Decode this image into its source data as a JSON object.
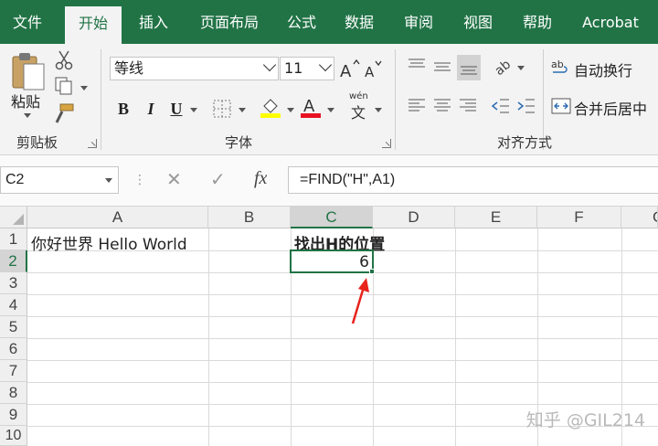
{
  "tabs": [
    "文件",
    "开始",
    "插入",
    "页面布局",
    "公式",
    "数据",
    "审阅",
    "视图",
    "帮助",
    "Acrobat"
  ],
  "active_tab": "开始",
  "ribbon": {
    "clipboard": {
      "paste_label": "粘贴",
      "group_label": "剪贴板"
    },
    "font": {
      "font_name": "等线",
      "font_size": "11",
      "bold": "B",
      "italic": "I",
      "underline": "U",
      "phonetic_top": "wén",
      "phonetic_bottom": "文",
      "group_label": "字体",
      "highlight_color": "#ffff00",
      "font_color": "#e81123"
    },
    "alignment": {
      "wrap_text": "自动换行",
      "merge_center": "合并后居中",
      "group_label": "对齐方式"
    }
  },
  "formula_bar": {
    "name_box": "C2",
    "fx": "fx",
    "formula": "=FIND(\"H\",A1)"
  },
  "grid": {
    "columns": [
      "A",
      "B",
      "C",
      "D",
      "E",
      "F",
      "G"
    ],
    "selected_column": "C",
    "rows": [
      "1",
      "2",
      "3",
      "4",
      "5",
      "6",
      "7",
      "8",
      "9",
      "10"
    ],
    "selected_row": "2",
    "cells": {
      "A1": "你好世界 Hello World",
      "C1": "找出H的位置",
      "C2": "6"
    },
    "selected_cell": "C2",
    "accent_color": "#217346",
    "arrow_color": "#e8231b"
  },
  "watermark": "知乎 @GIL214"
}
